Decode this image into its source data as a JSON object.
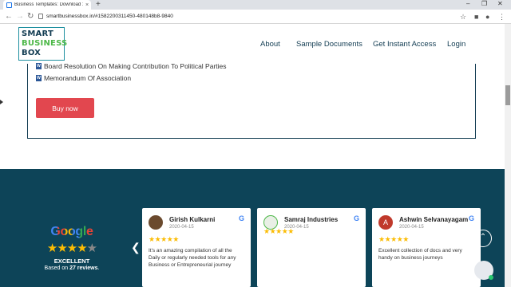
{
  "browser": {
    "tab_title": "Business Templates: Download 10",
    "url": "smartbusinessbox.in/#1582200311450-480148b8-9840"
  },
  "brand": {
    "logo_line1": "SMART",
    "logo_line2": "BUSINESS",
    "logo_line3": "BOX",
    "primary": "#123c52",
    "accent": "#4db848"
  },
  "nav": {
    "about": "About",
    "samples": "Sample Documents",
    "access": "Get Instant Access",
    "login": "Login"
  },
  "card": {
    "doc1": "Board Resolution On Making Contribution To Political Parties",
    "doc2": "Memorandum Of Association",
    "buy_label": "Buy now",
    "buy_color": "#e2474f"
  },
  "reviews": {
    "google_word": "Google",
    "rating_word": "EXCELLENT",
    "based_prefix": "Based on",
    "count": "27 reviews",
    "count_suffix": ".",
    "items": [
      {
        "name": "Girish Kulkarni",
        "date": "2020-04-15",
        "text": "It's an amazing compilation of all the Daily or regularly needed tools for any Business or Entrepreneurial journey"
      },
      {
        "name": "Samraj Industries",
        "date": "2020-04-15",
        "text": ""
      },
      {
        "name": "Ashwin Selvanayagam",
        "date": "2020-04-15",
        "text": "Excellent collection of docs and very handy on business journeys",
        "initial": "A"
      }
    ]
  },
  "watermark": {
    "line1": "Activate Windows",
    "line2": "Go to Settings to activate Windows."
  }
}
